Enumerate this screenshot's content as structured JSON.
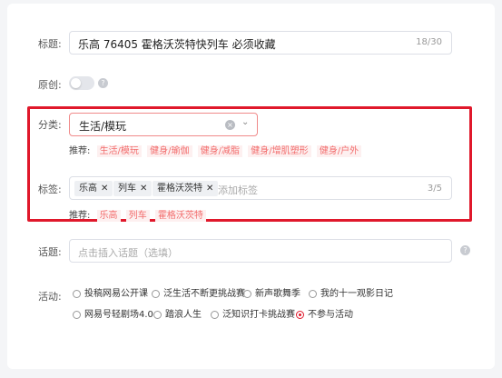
{
  "title_field": {
    "label": "标题:",
    "value": "乐高 76405 霍格沃茨特快列车 必须收藏",
    "count": "18/30"
  },
  "original_field": {
    "label": "原创:",
    "help": "?"
  },
  "category_field": {
    "label": "分类:",
    "value": "生活/模玩",
    "recommend_label": "推荐:",
    "recommendations": [
      "生活/模玩",
      "健身/瑜伽",
      "健身/减脂",
      "健身/增肌塑形",
      "健身/户外"
    ]
  },
  "tags_field": {
    "label": "标签:",
    "chips": [
      "乐高",
      "列车",
      "霍格沃茨特"
    ],
    "placeholder": "添加标签",
    "count": "3/5",
    "recommend_label": "推荐:",
    "recommendations": [
      "乐高",
      "列车",
      "霍格沃茨特"
    ]
  },
  "topic_field": {
    "label": "话题:",
    "placeholder": "点击插入话题（选填）",
    "help": "?"
  },
  "activity_field": {
    "label": "活动:",
    "options": [
      "投稿网易公开课",
      "泛生活不断更挑战赛",
      "新声歌舞季",
      "我的十一观影日记",
      "网易号轻剧场4.0",
      "踏浪人生",
      "泛知识打卡挑战赛",
      "不参与活动"
    ],
    "selected": "不参与活动"
  },
  "colors": {
    "highlight_border": "#e0182b",
    "recommend_text": "#f26d6d"
  }
}
